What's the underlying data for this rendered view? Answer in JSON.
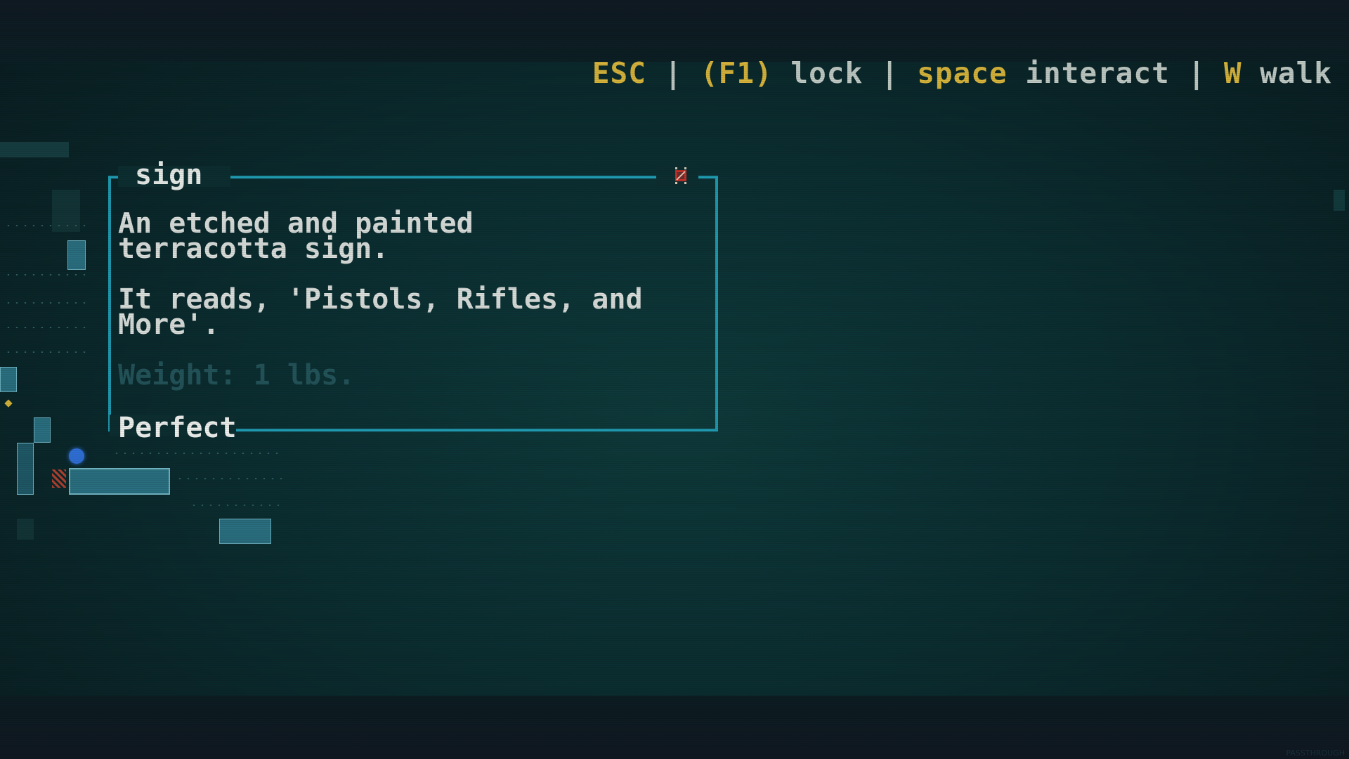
{
  "hint_bar": {
    "esc_key": "ESC",
    "sep1": "|",
    "lock_key": "(F1)",
    "lock_label": "lock",
    "sep2": "|",
    "interact_key": "space",
    "interact_label": "interact",
    "sep3": "|",
    "walk_key": "W",
    "walk_label": "walk"
  },
  "popup": {
    "title": "sign",
    "close_icon": "close-icon",
    "description_line1": "An etched and painted",
    "description_line2": "terracotta sign.",
    "reads_line1": "It reads, 'Pistols, Rifles, and",
    "reads_line2": "More'.",
    "weight": "Weight: 1 lbs.",
    "condition": "Perfect"
  },
  "colors": {
    "accent_border": "#1f9ab0",
    "key_highlight": "#d6b43b",
    "background": "#0b2e31",
    "close_icon": "#c0322a",
    "player": "#2f6fd6"
  },
  "watermark": "PASSTHROUGH"
}
